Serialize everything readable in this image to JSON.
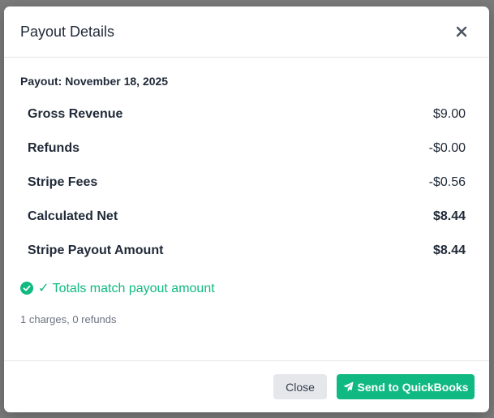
{
  "modal": {
    "title": "Payout Details",
    "payout_label": "Payout: November 18, 2025"
  },
  "summary": {
    "rows": [
      {
        "label": "Gross Revenue",
        "value": "$9.00"
      },
      {
        "label": "Refunds",
        "value": "-$0.00"
      },
      {
        "label": "Stripe Fees",
        "value": "-$0.56"
      },
      {
        "label": "Calculated Net",
        "value": "$8.44"
      },
      {
        "label": "Stripe Payout Amount",
        "value": "$8.44"
      }
    ],
    "match_text": "✓ Totals match payout amount",
    "counts_text": "1 charges, 0 refunds"
  },
  "footer": {
    "close_label": "Close",
    "send_label": "Send to QuickBooks"
  },
  "colors": {
    "accent_green": "#10b981",
    "backdrop": "#7b7b7b",
    "button_gray": "#e5e7eb"
  },
  "icons": {
    "close": "close-icon",
    "match": "check-circle-icon",
    "send": "paper-plane-icon"
  }
}
